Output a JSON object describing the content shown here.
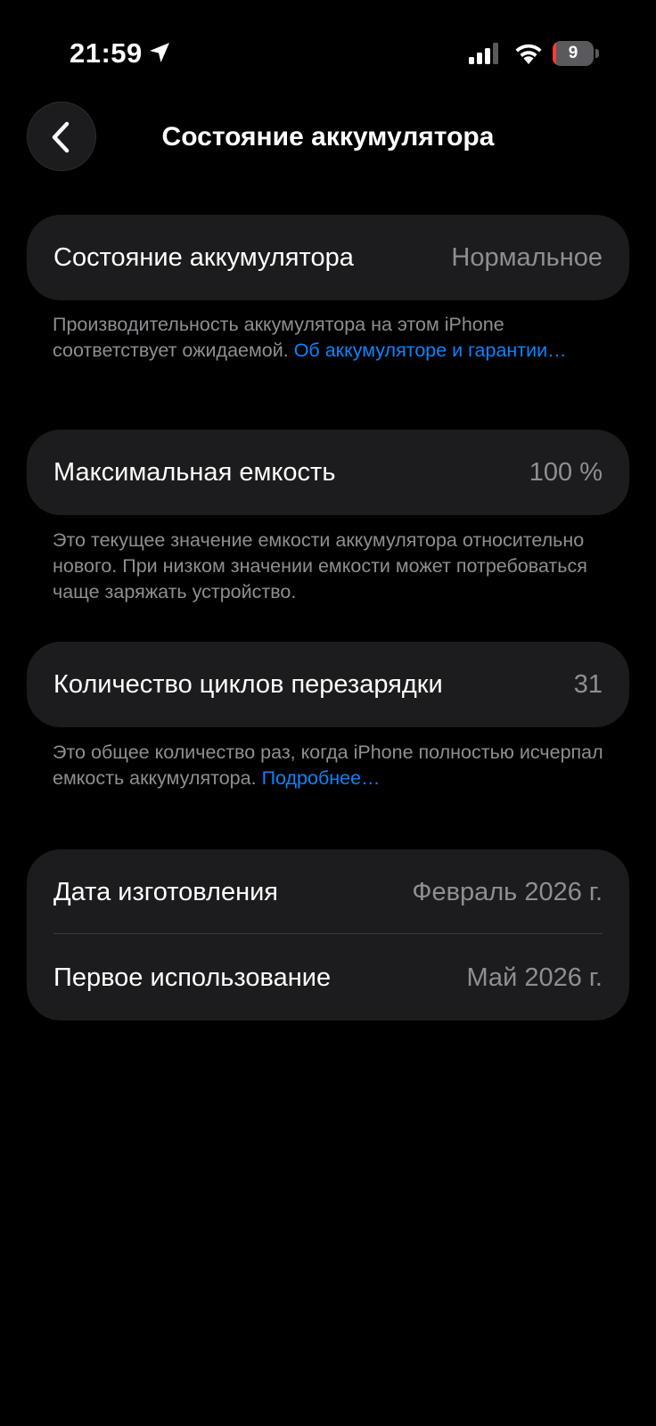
{
  "status_bar": {
    "time": "21:59",
    "battery_level": "9",
    "battery_fraction": 0.09,
    "colors": {
      "battery_low": "#ff3b30"
    }
  },
  "nav": {
    "back_icon": "chevron-left-icon",
    "title": "Состояние аккумулятора"
  },
  "battery_health": {
    "label": "Состояние аккумулятора",
    "value": "Нормальное",
    "footnote_text": "Производительность аккумулятора на этом iPhone соответствует ожидаемой. ",
    "footnote_link": "Об аккумуляторе и гарантии…"
  },
  "max_capacity": {
    "label": "Максимальная емкость",
    "value": "100 %",
    "footnote_text": "Это текущее значение емкости аккумулятора относительно нового. При низком значении емкости может потребоваться чаще заряжать устройство."
  },
  "cycle_count": {
    "label": "Количество циклов перезарядки",
    "value": "31",
    "footnote_text": "Это общее количество раз, когда iPhone полностью исчерпал емкость аккумулятора. ",
    "footnote_link": "Подробнее…"
  },
  "dates": {
    "manufacture_label": "Дата изготовления",
    "manufacture_value": "Февраль 2026 г.",
    "first_use_label": "Первое использование",
    "first_use_value": "Май 2026 г."
  },
  "colors": {
    "background": "#000000",
    "card": "#1c1c1e",
    "secondary_text": "#8e8e93",
    "link": "#0a84ff"
  }
}
